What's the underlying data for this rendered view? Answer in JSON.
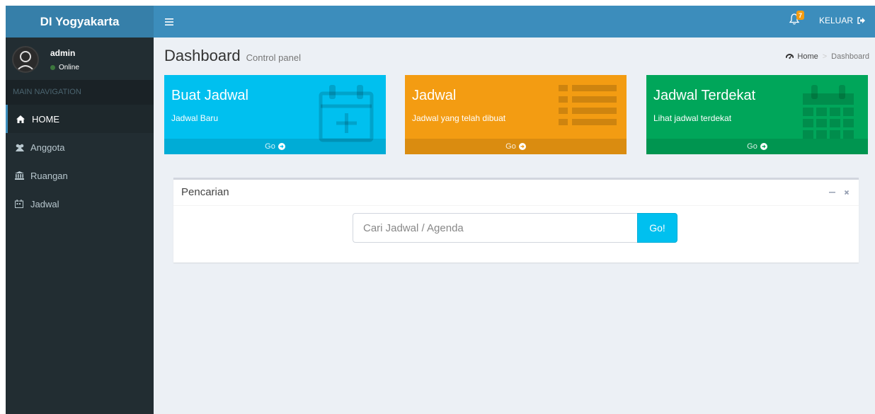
{
  "brand": {
    "title": "DI Yogyakarta"
  },
  "user": {
    "name": "admin",
    "status": "Online"
  },
  "sidebar": {
    "header": "MAIN NAVIGATION",
    "items": [
      {
        "label": "HOME",
        "icon": "home-icon"
      },
      {
        "label": "Anggota",
        "icon": "users-icon"
      },
      {
        "label": "Ruangan",
        "icon": "bank-icon"
      },
      {
        "label": "Jadwal",
        "icon": "calendar-icon"
      }
    ]
  },
  "topbar": {
    "notif_count": "7",
    "logout_label": "KELUAR"
  },
  "header": {
    "title": "Dashboard",
    "subtitle": "Control panel"
  },
  "breadcrumb": {
    "home": "Home",
    "current": "Dashboard"
  },
  "boxes": [
    {
      "title": "Buat Jadwal",
      "desc": "Jadwal Baru",
      "footer": "Go",
      "color": "#00c0ef",
      "icon": "calendar-plus-icon"
    },
    {
      "title": "Jadwal",
      "desc": "Jadwal yang telah dibuat",
      "footer": "Go",
      "color": "#f39c12",
      "icon": "list-icon"
    },
    {
      "title": "Jadwal Terdekat",
      "desc": "Lihat jadwal terdekat",
      "footer": "Go",
      "color": "#00a65a",
      "icon": "calendar-icon"
    }
  ],
  "search": {
    "title": "Pencarian",
    "placeholder": "Cari Jadwal / Agenda",
    "button": "Go!"
  }
}
